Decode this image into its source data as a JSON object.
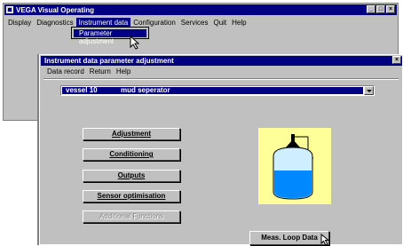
{
  "background_window": {
    "title": "VEGA Visual Operating",
    "controls": {
      "minimize": "_",
      "maximize": "□",
      "close": "×"
    },
    "menu": [
      "Display",
      "Diagnostics",
      "Instrument data",
      "Configuration",
      "Services",
      "Quit",
      "Help"
    ],
    "active_menu_index": 2,
    "dropdown": {
      "items": [
        "Parameter adjustment"
      ]
    }
  },
  "dialog": {
    "title": "Instrument data parameter adjustment",
    "close": "×",
    "menu": [
      "Data record",
      "Return",
      "Help"
    ],
    "vessel_select": {
      "number": "vessel 10",
      "name": "mud seperator"
    },
    "buttons": [
      {
        "label": "Adjustment",
        "enabled": true
      },
      {
        "label": "Conditioning",
        "enabled": true
      },
      {
        "label": "Outputs",
        "enabled": true
      },
      {
        "label": "Sensor optimisation",
        "enabled": true
      },
      {
        "label": "Additional Functions",
        "enabled": false
      }
    ],
    "tank_panel": {
      "fill_level": 0.6,
      "panel_color": "#ffff99",
      "liquid_color": "#0088ff"
    },
    "meas_button": {
      "label": "Meas. Loop Data"
    }
  },
  "colors": {
    "titlebar": "#000080",
    "face": "#c0c0c0"
  }
}
